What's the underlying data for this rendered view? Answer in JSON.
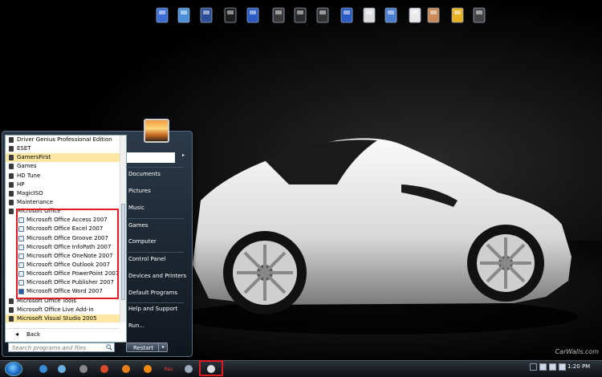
{
  "start_menu": {
    "programs": [
      {
        "label": "Driver Genius Professional Edition",
        "kind": "folder"
      },
      {
        "label": "ESET",
        "kind": "folder"
      },
      {
        "label": "GamersFirst",
        "kind": "folder",
        "highlight": true
      },
      {
        "label": "Games",
        "kind": "folder"
      },
      {
        "label": "HD Tune",
        "kind": "folder"
      },
      {
        "label": "HP",
        "kind": "folder"
      },
      {
        "label": "MagicISO",
        "kind": "folder"
      },
      {
        "label": "Maintenance",
        "kind": "folder"
      },
      {
        "label": "Microsoft Office",
        "kind": "folder"
      },
      {
        "label": "Microsoft Office Access 2007",
        "kind": "sub"
      },
      {
        "label": "Microsoft Office Excel 2007",
        "kind": "sub"
      },
      {
        "label": "Microsoft Office Groove 2007",
        "kind": "sub"
      },
      {
        "label": "Microsoft Office InfoPath 2007",
        "kind": "sub"
      },
      {
        "label": "Microsoft Office OneNote 2007",
        "kind": "sub"
      },
      {
        "label": "Microsoft Office Outlook 2007",
        "kind": "sub"
      },
      {
        "label": "Microsoft Office PowerPoint 2007",
        "kind": "sub"
      },
      {
        "label": "Microsoft Office Publisher 2007",
        "kind": "sub"
      },
      {
        "label": "Microsoft Office Word 2007",
        "kind": "sub"
      },
      {
        "label": "Microsoft Office Tools",
        "kind": "folder"
      },
      {
        "label": "Microsoft Office Live Add-in",
        "kind": "folder"
      },
      {
        "label": "Microsoft Visual Studio 2005",
        "kind": "folder",
        "highlight": true
      }
    ],
    "back_label": "Back",
    "search_placeholder": "Search programs and files",
    "right_items": [
      "Documents",
      "Pictures",
      "Music",
      "Games",
      "Computer",
      "Control Panel",
      "Devices and Printers",
      "Default Programs",
      "Help and Support",
      "Run..."
    ],
    "restart_label": "Restart",
    "user_arrow": "▸",
    "restart_arrow": "▸"
  },
  "desktop": {
    "watermark": "CarWalls.com"
  },
  "taskbar": {
    "clock": "1:20 PM",
    "pinned_icons": [
      "media-player-icon",
      "network-icon",
      "steam-icon",
      "chrome-icon",
      "firefox-icon",
      "vlc-icon",
      "res-icon",
      "package-icon",
      "calculator-icon"
    ],
    "res_label": "Res",
    "tray_icons": [
      "up-arrow-icon",
      "flag-icon",
      "network-tray-icon",
      "volume-icon"
    ]
  },
  "dock_icons": [
    "computer-icon",
    "network-globe-icon",
    "library-icon",
    "book-icon",
    "documents-icon",
    "pictures-icon",
    "music-icon",
    "videos-icon",
    "downloads-icon",
    "notes-icon",
    "screen-icon",
    "contacts-icon",
    "user-icon",
    "tools-icon",
    "recycle-bin-icon"
  ],
  "colors": {
    "highlight_yellow": "#fbe6a2",
    "annotation_red": "#e01a22",
    "accent_blue": "#1f6fc9"
  }
}
